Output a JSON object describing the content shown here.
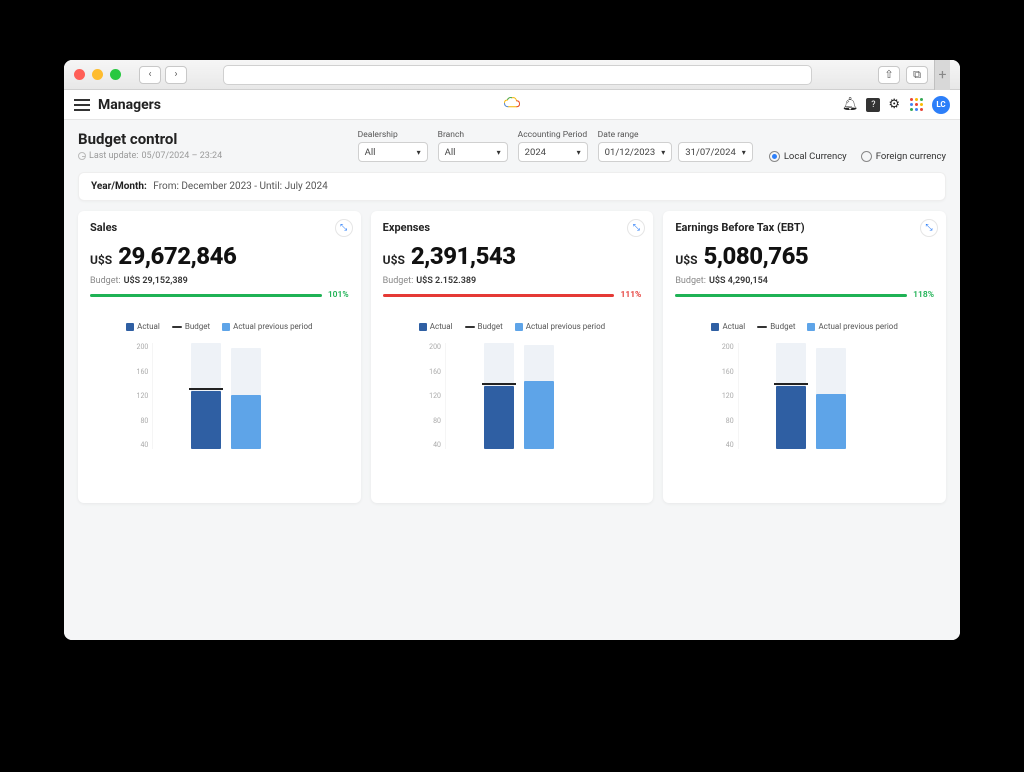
{
  "appbar": {
    "title": "Managers",
    "avatar_initials": "LC"
  },
  "page": {
    "title": "Budget control",
    "last_update_label": "Last update:",
    "last_update_value": "05/07/2024 – 23:24"
  },
  "filters": {
    "dealership": {
      "label": "Dealership",
      "value": "All"
    },
    "branch": {
      "label": "Branch",
      "value": "All"
    },
    "period": {
      "label": "Accounting Period",
      "value": "2024"
    },
    "daterange": {
      "label": "Date range",
      "from": "01/12/2023",
      "to": "31/07/2024"
    },
    "currency_local": "Local Currency",
    "currency_foreign": "Foreign currency"
  },
  "range_bar": {
    "label": "Year/Month:",
    "text": "From: December 2023 - Until: July 2024"
  },
  "legend": {
    "actual": "Actual",
    "budget": "Budget",
    "prev": "Actual previous period"
  },
  "y_ticks": [
    "200",
    "160",
    "120",
    "80",
    "40"
  ],
  "cards": {
    "sales": {
      "title": "Sales",
      "currency": "U$S",
      "amount": "29,672,846",
      "budget_label": "Budget:",
      "budget_value": "U$S 29,152,389",
      "pct": "101%",
      "pct_color": "green"
    },
    "expenses": {
      "title": "Expenses",
      "currency": "U$S",
      "amount": "2,391,543",
      "budget_label": "Budget:",
      "budget_value": "U$S 2.152.389",
      "pct": "111%",
      "pct_color": "red"
    },
    "ebt": {
      "title": "Earnings Before Tax (EBT)",
      "currency": "U$S",
      "amount": "5,080,765",
      "budget_label": "Budget:",
      "budget_value": "U$S 4,290,154",
      "pct": "118%",
      "pct_color": "green"
    }
  },
  "chart_data": [
    {
      "type": "bar",
      "card": "sales",
      "ylim": [
        0,
        200
      ],
      "series": [
        {
          "name": "Actual",
          "value": 110,
          "budget": 112,
          "max": 200
        },
        {
          "name": "Actual previous period",
          "value": 102,
          "max": 190
        }
      ]
    },
    {
      "type": "bar",
      "card": "expenses",
      "ylim": [
        0,
        200
      ],
      "series": [
        {
          "name": "Actual",
          "value": 118,
          "budget": 120,
          "max": 200
        },
        {
          "name": "Actual previous period",
          "value": 128,
          "max": 196
        }
      ]
    },
    {
      "type": "bar",
      "card": "ebt",
      "ylim": [
        0,
        200
      ],
      "series": [
        {
          "name": "Actual",
          "value": 118,
          "budget": 120,
          "max": 200
        },
        {
          "name": "Actual previous period",
          "value": 104,
          "max": 190
        }
      ]
    }
  ]
}
